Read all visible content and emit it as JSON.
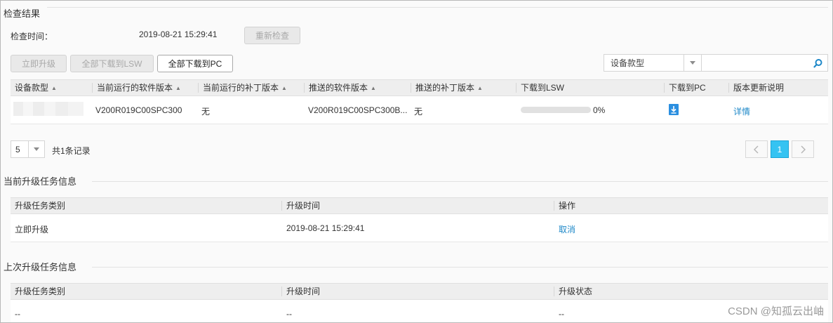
{
  "check": {
    "section_title": "检查结果",
    "time_label": "检查时间：",
    "time_value": "2019-08-21 15:29:41",
    "recheck_label": "重新检查"
  },
  "toolbar": {
    "upgrade_now": "立即升级",
    "download_all_lsw": "全部下载到LSW",
    "download_all_pc": "全部下载到PC"
  },
  "filter": {
    "field": "设备款型",
    "query": ""
  },
  "result_table": {
    "headers": [
      "设备款型",
      "当前运行的软件版本",
      "当前运行的补丁版本",
      "推送的软件版本",
      "推送的补丁版本",
      "下载到LSW",
      "下载到PC",
      "版本更新说明"
    ],
    "rows": [
      {
        "device_model": "",
        "current_software": "V200R019C00SPC300",
        "current_patch": "无",
        "pushed_software": "V200R019C00SPC300B...",
        "pushed_patch": "无",
        "lsw_progress_text": "0%",
        "lsw_progress": 0,
        "details_link": "详情"
      }
    ]
  },
  "pager": {
    "page_size": "5",
    "total_text": "共1条记录",
    "current_page": "1"
  },
  "current_task": {
    "section_title": "当前升级任务信息",
    "headers": [
      "升级任务类别",
      "升级时间",
      "操作"
    ],
    "rows": [
      {
        "type": "立即升级",
        "time": "2019-08-21 15:29:41",
        "action": "取消"
      }
    ]
  },
  "last_task": {
    "section_title": "上次升级任务信息",
    "headers": [
      "升级任务类别",
      "升级时间",
      "升级状态"
    ],
    "rows": [
      {
        "type": "--",
        "time": "--",
        "status": "--"
      }
    ]
  },
  "watermark": "CSDN @知孤云出岫",
  "colors": {
    "link": "#1e88c8",
    "page_active": "#35c3f2",
    "download_icon": "#2b8fe0"
  }
}
